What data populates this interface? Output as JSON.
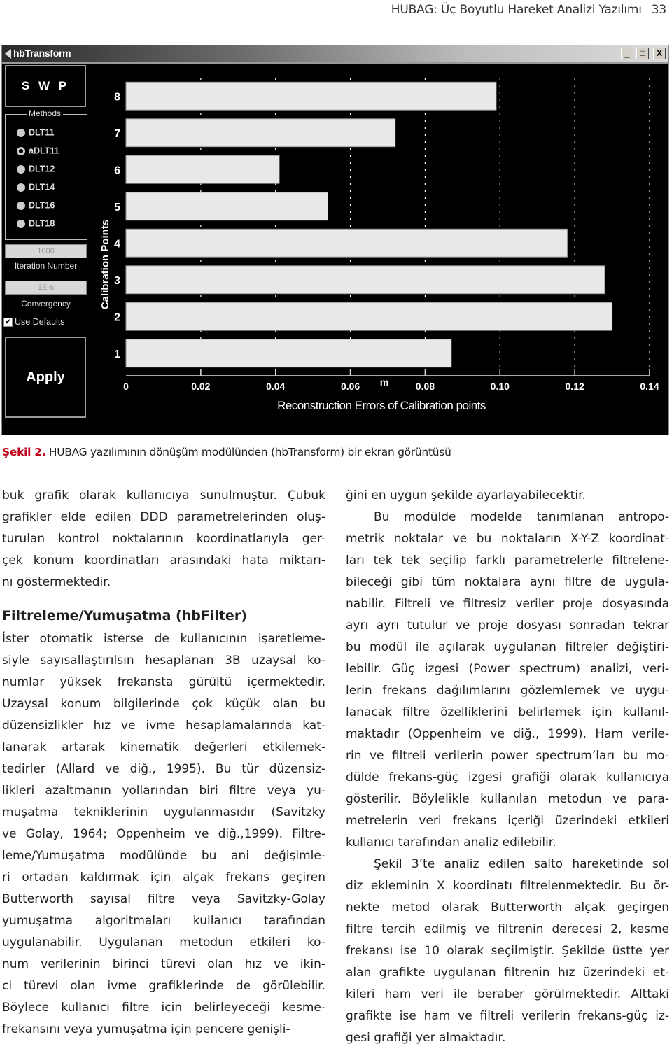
{
  "running_head": {
    "title": "HUBAG: Üç Boyutlu Hareket Analizi Yazılımı",
    "page": "33"
  },
  "window": {
    "title": "hbTransform",
    "controls": {
      "minimize": "_",
      "maximize": "□",
      "close": "X"
    },
    "swp_label": "S W P",
    "methods": {
      "legend": "Methods",
      "options": [
        {
          "label": "DLT11",
          "selected": false
        },
        {
          "label": "aDLT11",
          "selected": true
        },
        {
          "label": "DLT12",
          "selected": false
        },
        {
          "label": "DLT14",
          "selected": false
        },
        {
          "label": "DLT16",
          "selected": false
        },
        {
          "label": "DLT18",
          "selected": false
        }
      ]
    },
    "iteration_number": {
      "value": "1000",
      "label": "Iteration Number"
    },
    "convergency": {
      "value": "1E-6",
      "label": "Convergency"
    },
    "use_defaults": {
      "label": "Use Defaults",
      "checked": true,
      "check_glyph": "✔"
    },
    "apply_label": "Apply"
  },
  "chart_data": {
    "type": "bar",
    "orientation": "horizontal",
    "title": "Reconstruction Errors of Calibration points",
    "xlabel": "m",
    "ylabel": "Calibration Points",
    "categories": [
      "1",
      "2",
      "3",
      "4",
      "5",
      "6",
      "7",
      "8"
    ],
    "values": [
      0.087,
      0.13,
      0.128,
      0.118,
      0.054,
      0.041,
      0.072,
      0.099
    ],
    "xlim": [
      0,
      0.14
    ],
    "xticks": [
      "0",
      "0.02",
      "0.04",
      "0.06",
      "0.08",
      "0.10",
      "0.12",
      "0.14"
    ],
    "grid": "vertical-dashed",
    "colors": {
      "background": "#000000",
      "bar": "#e8e8e8",
      "text": "#ffffff",
      "grid": "#ffffff"
    }
  },
  "caption": {
    "label": "Şekil 2.",
    "text": " HUBAG yazılımının dönüşüm modülünden (hbTransform) bir ekran görüntüsü"
  },
  "left_column": {
    "para1": [
      "buk grafik olarak kullanıcıya sunulmuştur. Çubuk",
      "grafikler elde edilen DDD parametrelerinden oluş-",
      "turulan kontrol noktalarının koordinatlarıyla ger-",
      "çek konum koordinatları arasındaki hata miktarı-",
      "nı göstermektedir."
    ],
    "heading": "Filtreleme/Yumuşatma (hbFilter)",
    "para2": [
      "İster otomatik isterse de kullanıcının işaretleme-",
      "siyle sayısallaştırılsın hesaplanan 3B uzaysal ko-",
      "numlar yüksek frekansta gürültü içermektedir.",
      "Uzaysal konum bilgilerinde çok küçük olan bu",
      "düzensizlikler hız ve ivme hesaplamalarında kat-",
      "lanarak artarak kinematik değerleri etkilemek-",
      "tedirler (Allard ve diğ., 1995). Bu tür düzensiz-",
      "likleri azaltmanın yollarından biri filtre veya yu-",
      "muşatma tekniklerinin uygulanmasıdır (Savitzky",
      "ve Golay, 1964; Oppenheim ve diğ.,1999). Filtre-",
      "leme/Yumuşatma modülünde bu ani değişimle-",
      "ri ortadan kaldırmak için alçak frekans geçiren",
      "Butterworth sayısal filtre veya Savitzky-Golay",
      "yumuşatma algoritmaları kullanıcı tarafından",
      "uygulanabilir. Uygulanan metodun etkileri ko-",
      "num verilerinin birinci türevi olan hız ve ikin-",
      "ci türevi olan ivme grafiklerinde de görülebilir.",
      "Böylece kullanıcı filtre için belirleyeceği kesme-",
      "frekansını veya yumuşatma için pencere genişli-"
    ]
  },
  "right_column": {
    "para1": [
      "ğini en uygun şekilde ayarlayabilecektir."
    ],
    "para2": [
      "Bu modülde modelde tanımlanan antropo-",
      "metrik noktalar ve bu noktaların X-Y-Z koordinat-",
      "ları tek tek seçilip farklı parametrelerle filtrelene-",
      "bileceği gibi tüm noktalara aynı filtre de uygula-",
      "nabilir. Filtreli ve filtresiz veriler proje dosyasında",
      "ayrı ayrı tutulur ve proje dosyası sonradan tekrar",
      "bu modül ile açılarak uygulanan filtreler değiştiri-",
      "lebilir. Güç izgesi (Power spectrum) analizi, veri-",
      "lerin frekans dağılımlarını gözlemlemek ve uygu-",
      "lanacak filtre özelliklerini belirlemek için kullanıl-",
      "maktadır (Oppenheim ve diğ., 1999). Ham verile-",
      "rin ve filtreli verilerin power spectrum’ları bu mo-",
      "dülde frekans-güç izgesi grafiği olarak kullanıcıya",
      "gösterilir. Böylelikle kullanılan metodun ve para-",
      "metrelerin veri frekans içeriği üzerindeki etkileri",
      "kullanıcı tarafından analiz edilebilir."
    ],
    "para3": [
      "Şekil 3’te analiz edilen salto hareketinde sol",
      "diz ekleminin X koordinatı filtrelenmektedir. Bu ör-",
      "nekte metod olarak Butterworth alçak geçirgen",
      "filtre tercih edilmiş ve filtrenin derecesi 2, kesme",
      "frekansı ise 10 olarak seçilmiştir. Şekilde üstte yer",
      "alan grafikte uygulanan filtrenin hız üzerindeki et-",
      "kileri ham veri ile beraber görülmektedir. Alttaki",
      "grafikte ise ham ve filtreli verilerin frekans-güç iz-",
      "gesi grafiği yer almaktadır."
    ]
  }
}
